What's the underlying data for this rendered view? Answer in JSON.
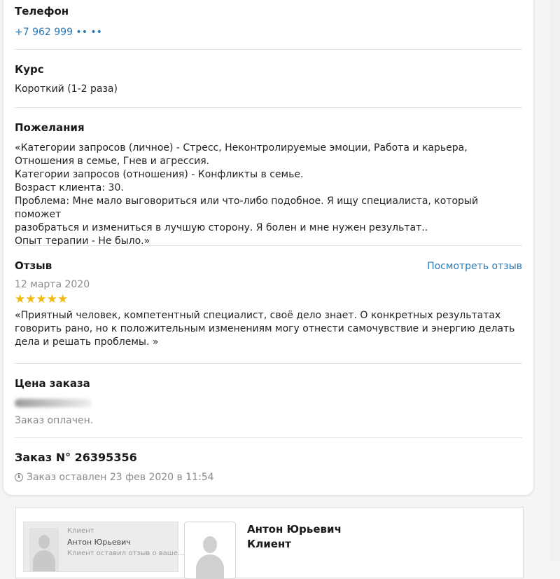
{
  "phone": {
    "heading": "Телефон",
    "number": "+7 962 999 •• ••"
  },
  "course": {
    "heading": "Курс",
    "value": "Короткий (1-2 раза)"
  },
  "wishes": {
    "heading": "Пожелания",
    "lines": [
      "«Категории запросов (личное) - Стресс, Неконтролируемые эмоции, Работа и карьера,",
      "Отношения в семье, Гнев и агрессия.",
      "Категории запросов (отношения) - Конфликты в семье.",
      "Возраст клиента: 30.",
      "Проблема: Мне мало выговориться или что-либо подобное. Я ищу специалиста, который поможет",
      "разобраться и измениться в лучшую сторону. Я болен и мне нужен результат..",
      "Опыт терапии - Не было.»"
    ]
  },
  "review": {
    "heading": "Отзыв",
    "view_link": "Посмотреть отзыв",
    "date": "12 марта 2020",
    "rating": 5,
    "rating_max": 5,
    "star_color": "#f0b90b",
    "lines": [
      "«Приятный человек, компетентный специалист, своё дело знает. О конкретных результатах",
      "говорить рано, но к положительным изменениям могу отнести самочувствие и энергию делать",
      "дела и решать проблемы. »"
    ]
  },
  "price": {
    "heading": "Цена заказа",
    "status": "Заказ оплачен."
  },
  "order": {
    "heading": "Заказ N° 26395356",
    "created": "Заказ оставлен 23 фев 2020 в 11:54",
    "clock_icon": "clock-icon"
  },
  "client_card": {
    "mini": {
      "role": "Клиент",
      "name": "Антон Юрьевич",
      "note": "Клиент оставил отзыв о ваше..."
    },
    "name": "Антон Юрьевич",
    "role": "Клиент"
  },
  "colors": {
    "link": "#2a7ab5",
    "muted": "#8a8a8a",
    "divider": "#e2e2e2"
  }
}
